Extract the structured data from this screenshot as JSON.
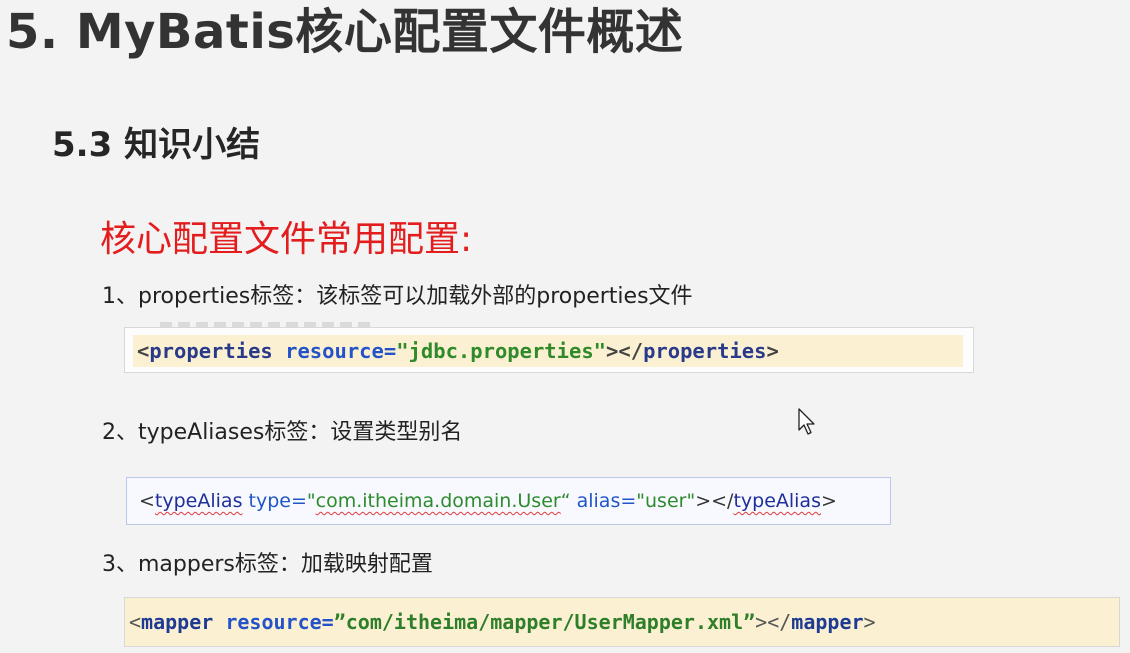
{
  "slide": {
    "title": "5. MyBatis核心配置文件概述",
    "subtitle": "5.3 知识小结",
    "heading": "核心配置文件常用配置:",
    "items": [
      {
        "label": "1、properties标签：该标签可以加载外部的properties文件"
      },
      {
        "label": "2、typeAliases标签：设置类型别名"
      },
      {
        "label": "3、mappers标签：加载映射配置"
      }
    ]
  },
  "code": {
    "properties": {
      "open": "<",
      "tag": "properties",
      "attr": "resource=",
      "value": "\"jdbc.properties\"",
      "close_open": "></",
      "close_tag": "properties",
      "end": ">"
    },
    "typeAlias": {
      "open": "<",
      "tag": "typeAlias",
      "attr1": "type=",
      "val1_q": "\"",
      "val1": "com.itheima.domain.User",
      "val1_end": "“",
      "attr2": "alias=",
      "val2": "\"user\"",
      "close_open": "></",
      "close_tag": "typeAlias",
      "end": ">"
    },
    "mapper": {
      "open": "<",
      "tag": "mapper",
      "attr": "resource=",
      "value": "”com/itheima/mapper/UserMapper.xml”",
      "close_open": "></",
      "close_tag": "mapper",
      "end": ">"
    }
  },
  "colors": {
    "background": "#f3f3f3",
    "heading": "#e31d1d",
    "highlight": "#fbf1d2"
  },
  "icons": [
    "mouse-cursor-icon"
  ]
}
